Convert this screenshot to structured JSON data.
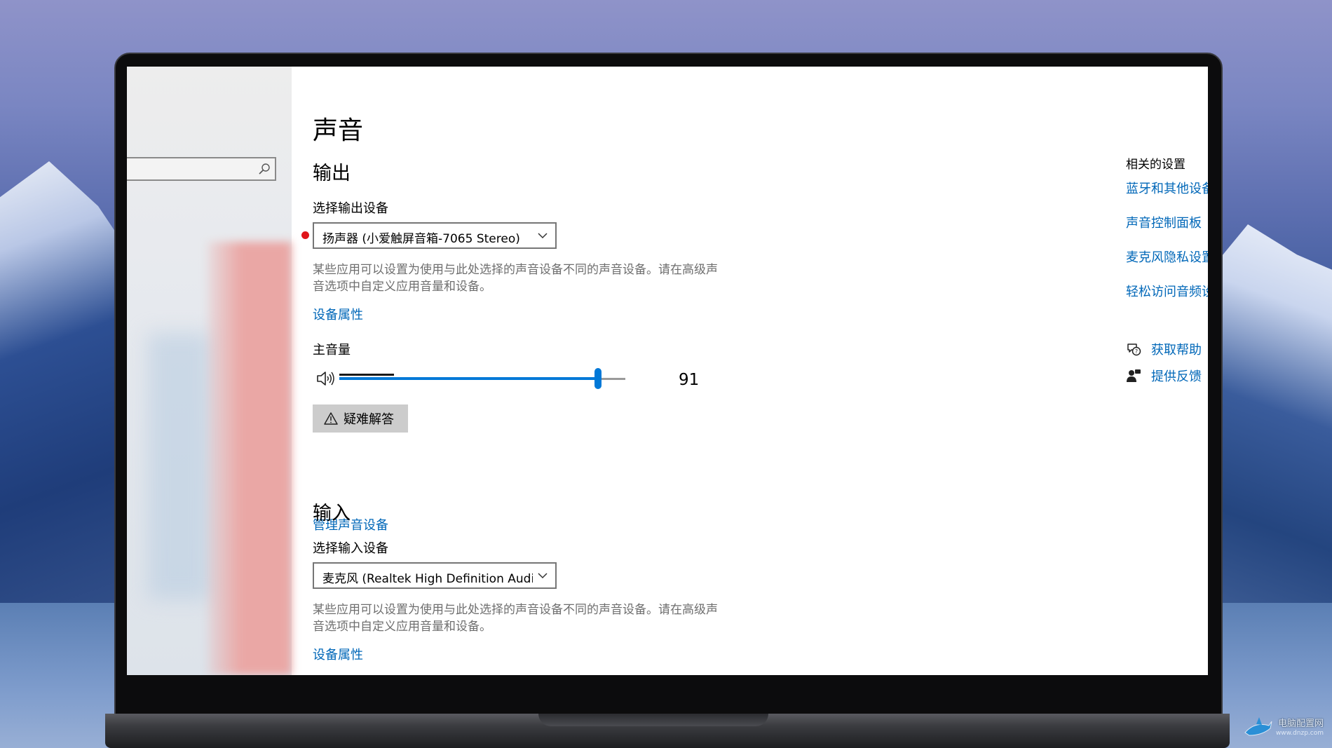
{
  "sound_page": {
    "title": "声音",
    "output": {
      "heading": "输出",
      "device_label": "选择输出设备",
      "device_value": "扬声器 (小爱触屏音箱-7065 Stereo)",
      "description": "某些应用可以设置为使用与此处选择的声音设备不同的声音设备。请在高级声音选项中自定义应用音量和设备。",
      "properties_link": "设备属性",
      "volume_label": "主音量",
      "volume_value": "91",
      "volume_level": 0.91,
      "troubleshoot_button": "疑难解答",
      "manage_link": "管理声音设备"
    },
    "input": {
      "heading": "输入",
      "device_label": "选择输入设备",
      "device_value": "麦克风 (Realtek High Definition Audi...",
      "description": "某些应用可以设置为使用与此处选择的声音设备不同的声音设备。请在高级声音选项中自定义应用音量和设备。",
      "properties_link": "设备属性"
    }
  },
  "related": {
    "title": "相关的设置",
    "links": [
      "蓝牙和其他设备",
      "声音控制面板",
      "麦克风隐私设置",
      "轻松访问音频设"
    ],
    "help": "获取帮助",
    "feedback": "提供反馈"
  },
  "watermark": {
    "text": "电脑配置网",
    "url": "www.dnzp.com"
  },
  "colors": {
    "accent": "#0078d7",
    "link": "#0067b8",
    "marker": "#e0151a"
  }
}
